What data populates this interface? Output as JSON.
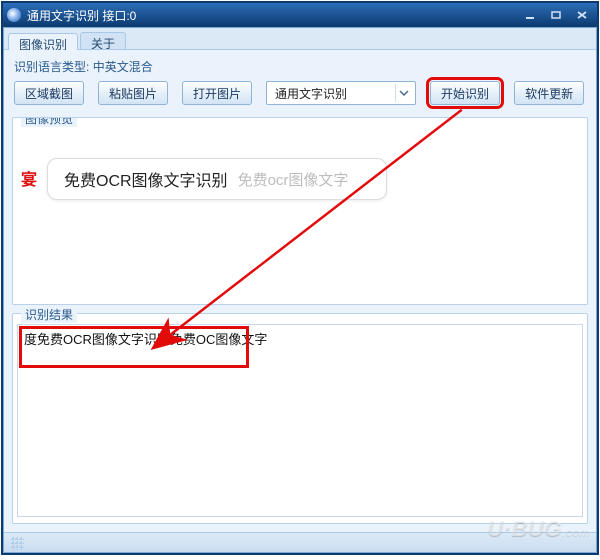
{
  "window": {
    "title": "通用文字识别 接口:0"
  },
  "tabs": {
    "items": [
      {
        "label": "图像识别"
      },
      {
        "label": "关于"
      }
    ]
  },
  "lang_row": {
    "label": "识别语言类型:",
    "value": "中英文混合"
  },
  "toolbar": {
    "btn_region": "区域截图",
    "btn_paste": "粘贴图片",
    "btn_open": "打开图片",
    "select_value": "通用文字识别",
    "btn_start": "开始识别",
    "btn_update": "软件更新"
  },
  "preview": {
    "groupbox_title": "图像预览",
    "badge": "宴",
    "pill_strong": "免费OCR图像文字识别",
    "pill_hint": "免费ocr图像文字"
  },
  "result": {
    "groupbox_title": "识别结果",
    "text": "度免费OCR图像文字识别免费OC图像文字"
  },
  "watermark": {
    "main": "U·BUG",
    "sub": ".com"
  }
}
